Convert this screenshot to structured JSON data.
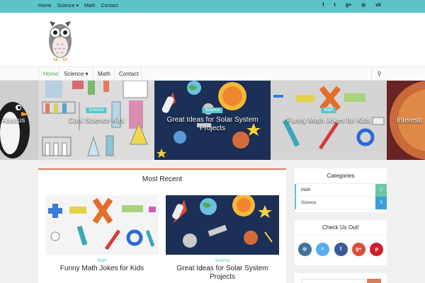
{
  "topbar": {
    "nav": [
      "Home",
      "Science ▾",
      "Math",
      "Contact"
    ],
    "social_icons": [
      "facebook-icon",
      "twitter-icon",
      "google-plus-icon",
      "instagram-icon",
      "vk-icon"
    ],
    "social_glyphs": [
      "f",
      "t",
      "g+",
      "◎",
      "vk"
    ]
  },
  "mainnav": {
    "home": "Home",
    "science": "Science ▾",
    "math": "Math",
    "contact": "Contact",
    "search_glyph": "⚲"
  },
  "slider": {
    "slides": [
      {
        "title": "Abacus",
        "category": ""
      },
      {
        "title": "Cool Science Kits",
        "category": "Science"
      },
      {
        "title": "Great Ideas for Solar System Projects",
        "category": "Science"
      },
      {
        "title": "Funny Math Jokes for Kids",
        "category": "Math"
      },
      {
        "title": "Interesti",
        "category": ""
      }
    ]
  },
  "recent": {
    "title": "Most Recent",
    "posts": [
      {
        "category": "Math",
        "title": "Funny Math Jokes for Kids"
      },
      {
        "category": "Science",
        "title": "Great Ideas for Solar System Projects"
      }
    ]
  },
  "sidebar": {
    "categories_title": "Categories",
    "categories": [
      {
        "name": "Math",
        "count": "2"
      },
      {
        "name": "Science",
        "count": "3"
      }
    ],
    "checkout_title": "Check Us Out!",
    "social": [
      {
        "icon": "instagram-icon",
        "glyph": "◎",
        "color": "#3f729b"
      },
      {
        "icon": "twitter-icon",
        "glyph": "t",
        "color": "#55acee"
      },
      {
        "icon": "facebook-icon",
        "glyph": "f",
        "color": "#3b5998"
      },
      {
        "icon": "google-plus-icon",
        "glyph": "g+",
        "color": "#dd4b39"
      },
      {
        "icon": "pinterest-icon",
        "glyph": "p",
        "color": "#cb2027"
      }
    ]
  },
  "colors": {
    "accent": "#5bc4c8",
    "nav_active": "#4cae4c",
    "recent_border": "#e07b5a"
  }
}
